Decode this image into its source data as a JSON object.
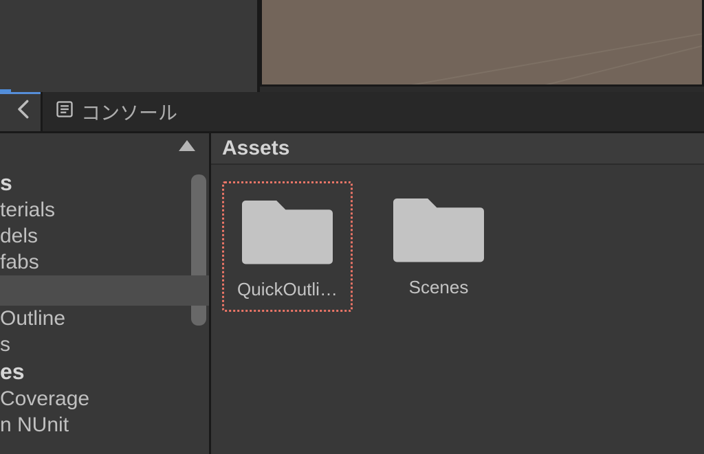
{
  "tabs": {
    "console_label": "コンソール"
  },
  "tree": {
    "partials": {
      "root_head": "s",
      "item1": "terials",
      "item2": "dels",
      "item3": "fabs",
      "item5_outline": "Outline",
      "item6": "s",
      "item7_head": "es",
      "item8": "Coverage",
      "item9": "n NUnit"
    }
  },
  "content": {
    "header": "Assets",
    "folders": [
      {
        "name": "QuickOutli…",
        "highlight": true
      },
      {
        "name": "Scenes",
        "highlight": false
      }
    ]
  },
  "colors": {
    "highlight_border": "#ed7668",
    "bg_panel": "#383838",
    "bg_dark": "#2b2b2b"
  }
}
